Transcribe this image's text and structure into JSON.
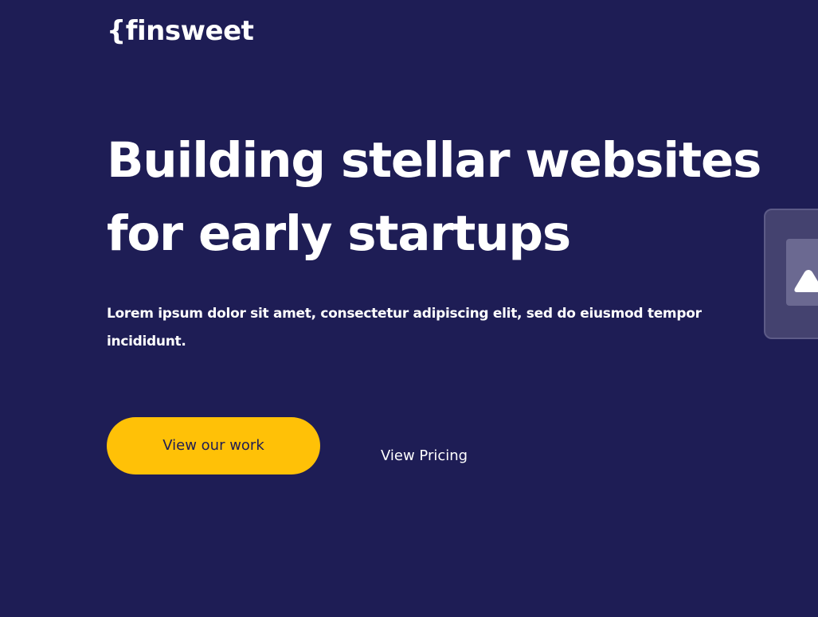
{
  "header": {
    "logo_text": "{finsweet"
  },
  "hero": {
    "heading_line1": "Building stellar websites",
    "heading_line2": "for early startups",
    "subtext": "Lorem ipsum dolor sit amet, consectetur adipiscing elit, sed do eiusmod tempor incididunt.",
    "primary_cta_label": "View our work",
    "secondary_cta_label": "View Pricing"
  },
  "side_widget": {
    "icon": "triangle-up-icon"
  },
  "colors": {
    "background": "#1e1d55",
    "accent": "#ffc107",
    "text": "#ffffff"
  }
}
